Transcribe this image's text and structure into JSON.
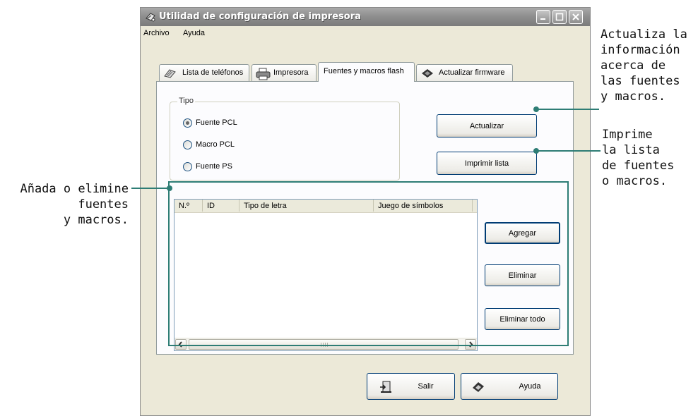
{
  "window": {
    "title": "Utilidad de configuración de impresora",
    "menu": [
      "Archivo",
      "Ayuda"
    ]
  },
  "tabs": [
    {
      "label": "Lista de teléfonos",
      "icon": "phonebook-icon",
      "active": false
    },
    {
      "label": "Impresora",
      "icon": "printer-icon",
      "active": false
    },
    {
      "label": "Fuentes y macros flash",
      "icon": "",
      "active": true
    },
    {
      "label": "Actualizar firmware",
      "icon": "chip-icon",
      "active": false
    }
  ],
  "tipo": {
    "label": "Tipo",
    "options": [
      {
        "label": "Fuente PCL",
        "selected": true
      },
      {
        "label": "Macro PCL",
        "selected": false
      },
      {
        "label": "Fuente PS",
        "selected": false
      }
    ]
  },
  "buttons": {
    "update": "Actualizar",
    "print_list": "Imprimir lista",
    "add": "Agregar",
    "delete": "Eliminar",
    "delete_all": "Eliminar todo",
    "exit": "Salir",
    "help": "Ayuda"
  },
  "list": {
    "columns": [
      "N.º",
      "ID",
      "Tipo de letra",
      "Juego de símbolos"
    ],
    "rows": []
  },
  "annotations": {
    "left": [
      "Añada o elimine",
      "fuentes",
      "y macros."
    ],
    "update": [
      "Actualiza la",
      "información",
      "acerca de",
      "las fuentes",
      "y macros."
    ],
    "print": [
      "Imprime",
      "la lista",
      "de fuentes",
      "o macros."
    ]
  },
  "colors": {
    "callout": "#2e7d75",
    "window_bg": "#ece9d8",
    "titlebar": "#8f8f8f"
  }
}
